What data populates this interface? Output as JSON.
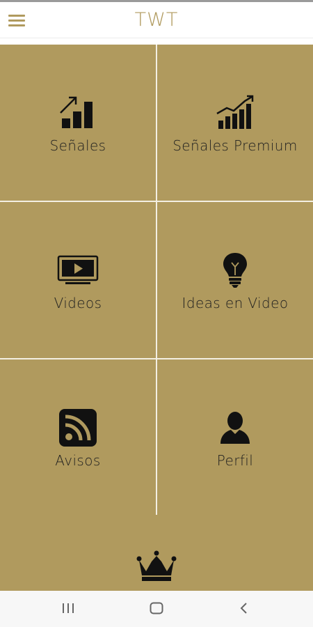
{
  "app": {
    "title": "TWT",
    "accent_color": "#b09a5e"
  },
  "tiles": [
    {
      "label": "Señales",
      "icon": "signals-chart-icon"
    },
    {
      "label": "Señales Premium",
      "icon": "premium-chart-icon"
    },
    {
      "label": "Videos",
      "icon": "tv-play-icon"
    },
    {
      "label": "Ideas en Video",
      "icon": "lightbulb-icon"
    },
    {
      "label": "Avisos",
      "icon": "rss-icon"
    },
    {
      "label": "Perfil",
      "icon": "user-icon"
    }
  ],
  "footer": {
    "icon": "crown-icon"
  },
  "navbar": {
    "buttons": [
      {
        "icon": "recent-apps-icon"
      },
      {
        "icon": "home-icon"
      },
      {
        "icon": "back-icon"
      }
    ]
  }
}
